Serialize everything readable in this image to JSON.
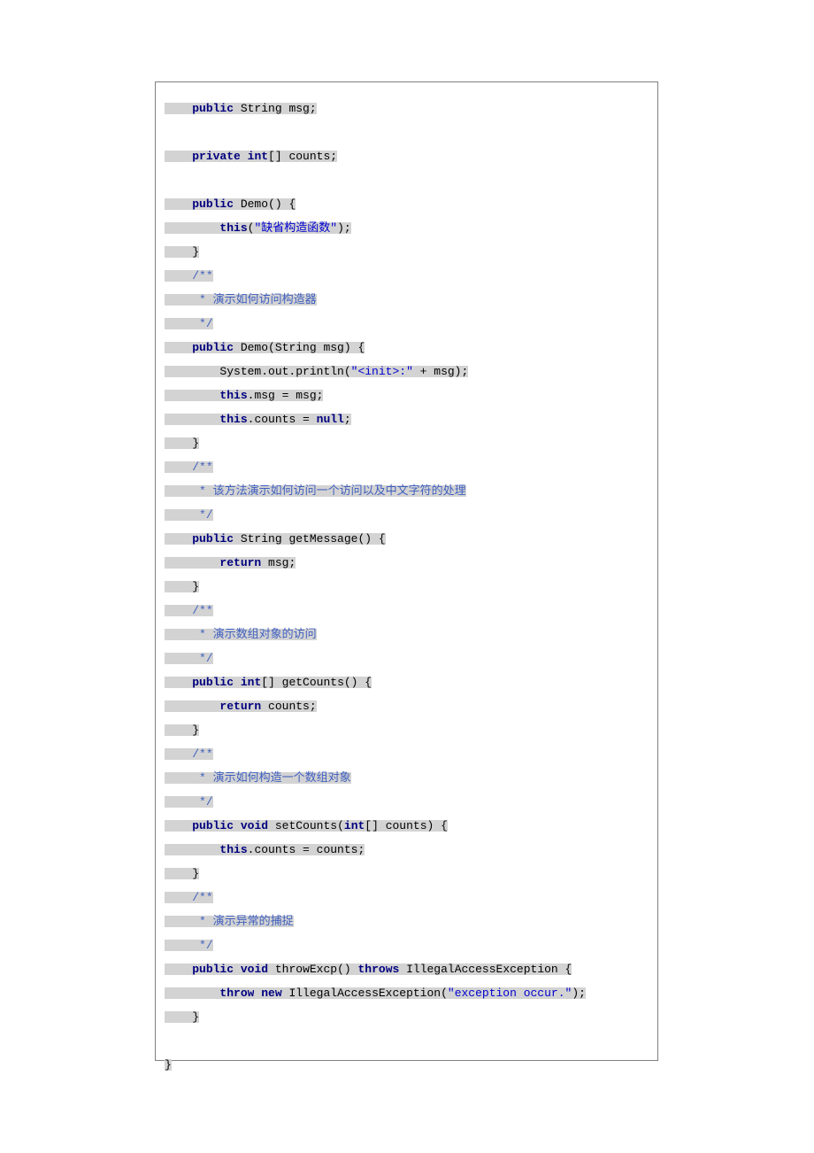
{
  "code": {
    "lines": [
      {
        "indent": "    ",
        "tokens": [
          {
            "t": "public",
            "c": "kw"
          },
          {
            "t": " String msg;",
            "c": "p"
          }
        ]
      },
      {
        "empty": true
      },
      {
        "indent": "    ",
        "tokens": [
          {
            "t": "private",
            "c": "kw"
          },
          {
            "t": " ",
            "c": "p"
          },
          {
            "t": "int",
            "c": "kw"
          },
          {
            "t": "[] counts;",
            "c": "p"
          }
        ]
      },
      {
        "empty": true
      },
      {
        "indent": "    ",
        "tokens": [
          {
            "t": "public",
            "c": "kw"
          },
          {
            "t": " Demo() {",
            "c": "p"
          }
        ]
      },
      {
        "indent": "        ",
        "tokens": [
          {
            "t": "this",
            "c": "kw"
          },
          {
            "t": "(",
            "c": "p"
          },
          {
            "t": "\"缺省构造函数\"",
            "c": "str"
          },
          {
            "t": ");",
            "c": "p"
          }
        ]
      },
      {
        "indent": "    ",
        "tokens": [
          {
            "t": "}",
            "c": "p"
          }
        ]
      },
      {
        "indent": "    ",
        "tokens": [
          {
            "t": "/**",
            "c": "cmt"
          }
        ]
      },
      {
        "indent": "     ",
        "tokens": [
          {
            "t": "* 演示如何访问构造器",
            "c": "cmt"
          }
        ]
      },
      {
        "indent": "     ",
        "tokens": [
          {
            "t": "*/",
            "c": "cmt"
          }
        ]
      },
      {
        "indent": "    ",
        "tokens": [
          {
            "t": "public",
            "c": "kw"
          },
          {
            "t": " Demo(String msg) {",
            "c": "p"
          }
        ]
      },
      {
        "indent": "        ",
        "tokens": [
          {
            "t": "System.out.println(",
            "c": "p"
          },
          {
            "t": "\"<init>:\"",
            "c": "str"
          },
          {
            "t": " + msg);",
            "c": "p"
          }
        ]
      },
      {
        "indent": "        ",
        "tokens": [
          {
            "t": "this",
            "c": "kw"
          },
          {
            "t": ".msg = msg;",
            "c": "p"
          }
        ]
      },
      {
        "indent": "        ",
        "tokens": [
          {
            "t": "this",
            "c": "kw"
          },
          {
            "t": ".counts = ",
            "c": "p"
          },
          {
            "t": "null",
            "c": "kw"
          },
          {
            "t": ";",
            "c": "p"
          }
        ]
      },
      {
        "indent": "    ",
        "tokens": [
          {
            "t": "}",
            "c": "p"
          }
        ]
      },
      {
        "indent": "    ",
        "tokens": [
          {
            "t": "/**",
            "c": "cmt"
          }
        ]
      },
      {
        "indent": "     ",
        "tokens": [
          {
            "t": "* 该方法演示如何访问一个访问以及中文字符的处理",
            "c": "cmt"
          }
        ]
      },
      {
        "indent": "     ",
        "tokens": [
          {
            "t": "*/",
            "c": "cmt"
          }
        ]
      },
      {
        "indent": "    ",
        "tokens": [
          {
            "t": "public",
            "c": "kw"
          },
          {
            "t": " String getMessage() {",
            "c": "p"
          }
        ]
      },
      {
        "indent": "        ",
        "tokens": [
          {
            "t": "return",
            "c": "kw"
          },
          {
            "t": " msg;",
            "c": "p"
          }
        ]
      },
      {
        "indent": "    ",
        "tokens": [
          {
            "t": "}",
            "c": "p"
          }
        ]
      },
      {
        "indent": "    ",
        "tokens": [
          {
            "t": "/**",
            "c": "cmt"
          }
        ]
      },
      {
        "indent": "     ",
        "tokens": [
          {
            "t": "* 演示数组对象的访问",
            "c": "cmt"
          }
        ]
      },
      {
        "indent": "     ",
        "tokens": [
          {
            "t": "*/",
            "c": "cmt"
          }
        ]
      },
      {
        "indent": "    ",
        "tokens": [
          {
            "t": "public",
            "c": "kw"
          },
          {
            "t": " ",
            "c": "p"
          },
          {
            "t": "int",
            "c": "kw"
          },
          {
            "t": "[] getCounts() {",
            "c": "p"
          }
        ]
      },
      {
        "indent": "        ",
        "tokens": [
          {
            "t": "return",
            "c": "kw"
          },
          {
            "t": " counts;",
            "c": "p"
          }
        ]
      },
      {
        "indent": "    ",
        "tokens": [
          {
            "t": "}",
            "c": "p"
          }
        ]
      },
      {
        "indent": "    ",
        "tokens": [
          {
            "t": "/**",
            "c": "cmt"
          }
        ]
      },
      {
        "indent": "     ",
        "tokens": [
          {
            "t": "* 演示如何构造一个数组对象",
            "c": "cmt"
          }
        ]
      },
      {
        "indent": "     ",
        "tokens": [
          {
            "t": "*/",
            "c": "cmt"
          }
        ]
      },
      {
        "indent": "    ",
        "tokens": [
          {
            "t": "public",
            "c": "kw"
          },
          {
            "t": " ",
            "c": "p"
          },
          {
            "t": "void",
            "c": "kw"
          },
          {
            "t": " setCounts(",
            "c": "p"
          },
          {
            "t": "int",
            "c": "kw"
          },
          {
            "t": "[] counts) {",
            "c": "p"
          }
        ]
      },
      {
        "indent": "        ",
        "tokens": [
          {
            "t": "this",
            "c": "kw"
          },
          {
            "t": ".counts = counts;",
            "c": "p"
          }
        ]
      },
      {
        "indent": "    ",
        "tokens": [
          {
            "t": "}",
            "c": "p"
          }
        ]
      },
      {
        "indent": "    ",
        "tokens": [
          {
            "t": "/**",
            "c": "cmt"
          }
        ]
      },
      {
        "indent": "     ",
        "tokens": [
          {
            "t": "* 演示异常的捕捉",
            "c": "cmt"
          }
        ]
      },
      {
        "indent": "     ",
        "tokens": [
          {
            "t": "*/",
            "c": "cmt"
          }
        ]
      },
      {
        "indent": "    ",
        "tokens": [
          {
            "t": "public",
            "c": "kw"
          },
          {
            "t": " ",
            "c": "p"
          },
          {
            "t": "void",
            "c": "kw"
          },
          {
            "t": " throwExcp() ",
            "c": "p"
          },
          {
            "t": "throws",
            "c": "kw"
          },
          {
            "t": " IllegalAccessException {",
            "c": "p"
          }
        ]
      },
      {
        "indent": "        ",
        "tokens": [
          {
            "t": "throw",
            "c": "kw"
          },
          {
            "t": " ",
            "c": "p"
          },
          {
            "t": "new",
            "c": "kw"
          },
          {
            "t": " IllegalAccessException(",
            "c": "p"
          },
          {
            "t": "\"exception occur.\"",
            "c": "str"
          },
          {
            "t": ");",
            "c": "p"
          }
        ]
      },
      {
        "indent": "    ",
        "tokens": [
          {
            "t": "}",
            "c": "p"
          }
        ]
      },
      {
        "empty": true
      },
      {
        "indent": "",
        "tokens": [
          {
            "t": "}",
            "c": "p"
          }
        ]
      }
    ]
  }
}
